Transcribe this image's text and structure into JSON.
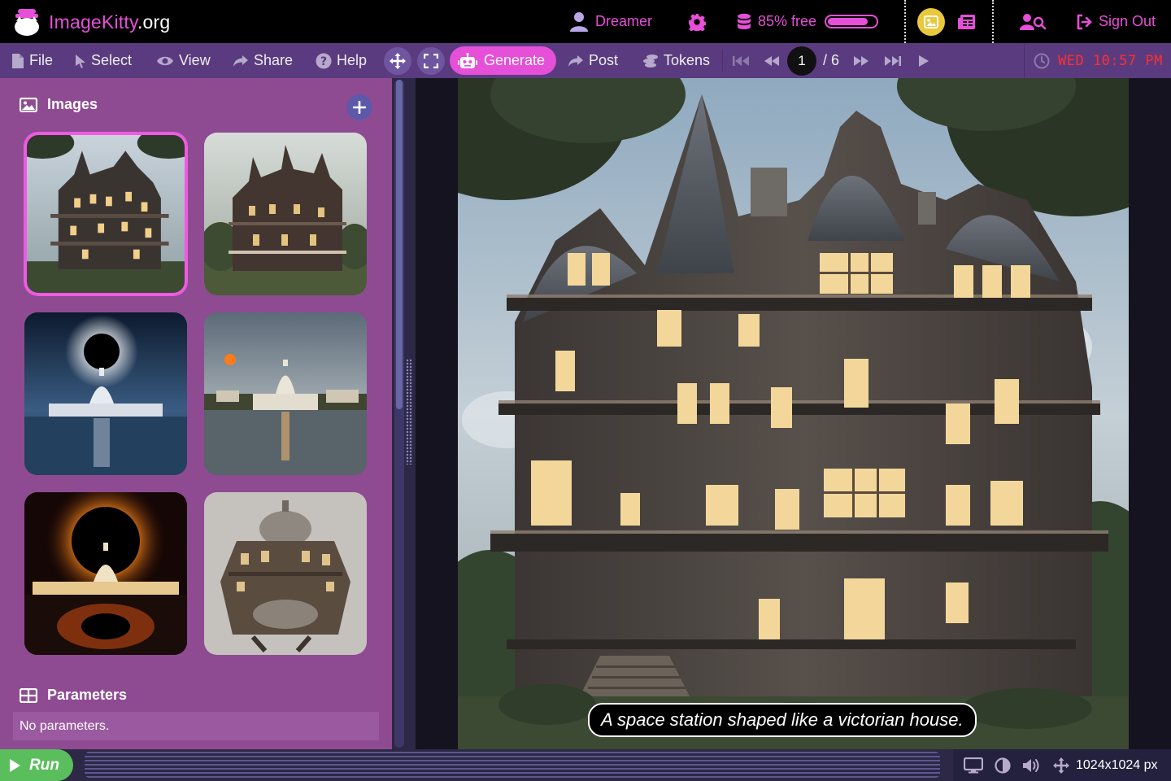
{
  "app": {
    "brand_main": "ImageKitty",
    "brand_tld": ".org"
  },
  "topbar": {
    "user_name": "Dreamer",
    "storage_label": "85% free",
    "storage_used_fraction": 0.85,
    "signout_label": "Sign Out"
  },
  "menubar": {
    "file": "File",
    "select": "Select",
    "view": "View",
    "share": "Share",
    "help": "Help",
    "generate": "Generate",
    "post": "Post",
    "tokens": "Tokens",
    "page_current": "1",
    "page_total": "/ 6",
    "clock": "WED 10:57 PM"
  },
  "left_panel": {
    "images_title": "Images",
    "parameters_title": "Parameters",
    "parameters_text": "No parameters.",
    "thumbnails": [
      {
        "subject": "victorian-space-station",
        "selected": true
      },
      {
        "subject": "victorian-mansion"
      },
      {
        "subject": "eclipse-capitol-blue"
      },
      {
        "subject": "capitol-moon-sunset"
      },
      {
        "subject": "eclipse-capitol-fire"
      },
      {
        "subject": "steampunk-station"
      }
    ]
  },
  "main": {
    "caption": "A space station shaped like a victorian house."
  },
  "bottombar": {
    "run_label": "Run",
    "resolution": "1024x1024 px"
  },
  "colors": {
    "accent": "#e64fd8",
    "menubar": "#5a3b7f",
    "panel": "#8e4b92",
    "run": "#5bbe5d",
    "clock": "#ff2f2f",
    "gallery_button": "#e9c93b"
  }
}
